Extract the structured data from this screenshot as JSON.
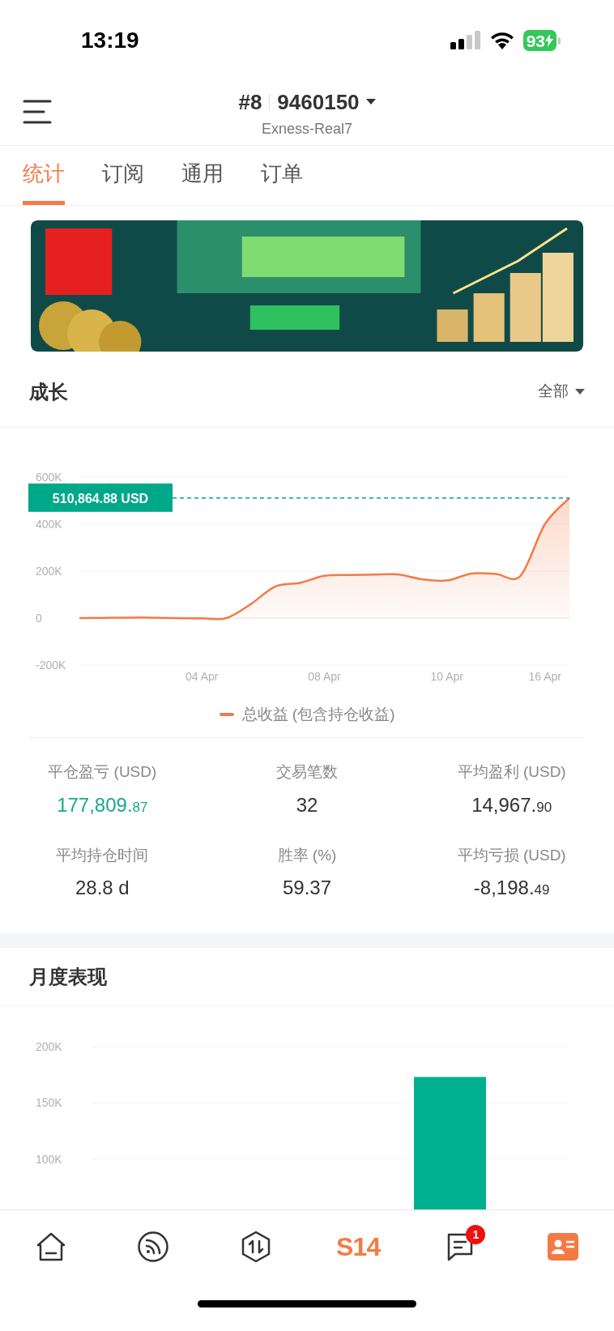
{
  "status_bar": {
    "time": "13:19",
    "battery": "93"
  },
  "header": {
    "account_index": "#8",
    "account_number": "9460150",
    "server": "Exness-Real7"
  },
  "tabs": [
    {
      "label": "统计",
      "selected": true
    },
    {
      "label": "订阅",
      "selected": false
    },
    {
      "label": "通用",
      "selected": false
    },
    {
      "label": "订单",
      "selected": false
    }
  ],
  "growth": {
    "title": "成长",
    "filter": "全部",
    "chart_data": {
      "type": "area",
      "categories": [
        null,
        null,
        null,
        null,
        null,
        "04 Apr",
        null,
        null,
        null,
        null,
        "08 Apr",
        null,
        null,
        null,
        null,
        "10 Apr",
        null,
        null,
        null,
        "16 Apr",
        null
      ],
      "series": [
        {
          "name": "总收益 (包含持仓收益)",
          "color": "#f47a45",
          "values": [
            0,
            1,
            2,
            2,
            0,
            -1,
            0,
            60,
            135,
            150,
            180,
            184,
            185,
            186,
            165,
            160,
            190,
            188,
            180,
            400,
            511
          ]
        }
      ],
      "ylim": [
        -200,
        600
      ],
      "ref_lines": [
        {
          "axis": "y",
          "value": 511,
          "label": "510,864.88 USD"
        }
      ],
      "yticks": [
        {
          "value": 600,
          "label": "600K"
        },
        {
          "value": 400,
          "label": "400K"
        },
        {
          "value": 200,
          "label": "200K"
        },
        {
          "value": 0,
          "label": "0"
        },
        {
          "value": -200,
          "label": "-200K"
        }
      ]
    }
  },
  "stats": [
    {
      "label": "平仓盈亏 (USD)",
      "value": "177,809.",
      "decimals": "87",
      "positive": true
    },
    {
      "label": "交易笔数",
      "value": "32",
      "positive": false
    },
    {
      "label": "平均盈利 (USD)",
      "value": "14,967.",
      "decimals": "90",
      "positive": false
    },
    {
      "label": "平均持仓时间",
      "value": "28.8 d",
      "positive": false
    },
    {
      "label": "胜率 (%)",
      "value": "59.37",
      "positive": false
    },
    {
      "label": "平均亏损 (USD)",
      "value": "-8,198.",
      "decimals": "49",
      "positive": false
    }
  ],
  "monthly": {
    "title": "月度表现",
    "chart_data": {
      "type": "bar",
      "categories": [
        null,
        null,
        null,
        null,
        null,
        null
      ],
      "series": [
        {
          "color": "#00b090",
          "values": [
            null,
            null,
            null,
            null,
            173,
            null
          ]
        }
      ],
      "ylim": [
        52,
        200
      ],
      "yticks": [
        {
          "value": 200,
          "label": "200K"
        },
        {
          "value": 150,
          "label": "150K"
        },
        {
          "value": 100,
          "label": "100K"
        }
      ]
    }
  },
  "bottom_nav": [
    {
      "kind": "home"
    },
    {
      "kind": "feed"
    },
    {
      "kind": "trade"
    },
    {
      "kind": "text",
      "label": "S14"
    },
    {
      "kind": "messages",
      "badge": "1"
    },
    {
      "kind": "profile"
    }
  ]
}
